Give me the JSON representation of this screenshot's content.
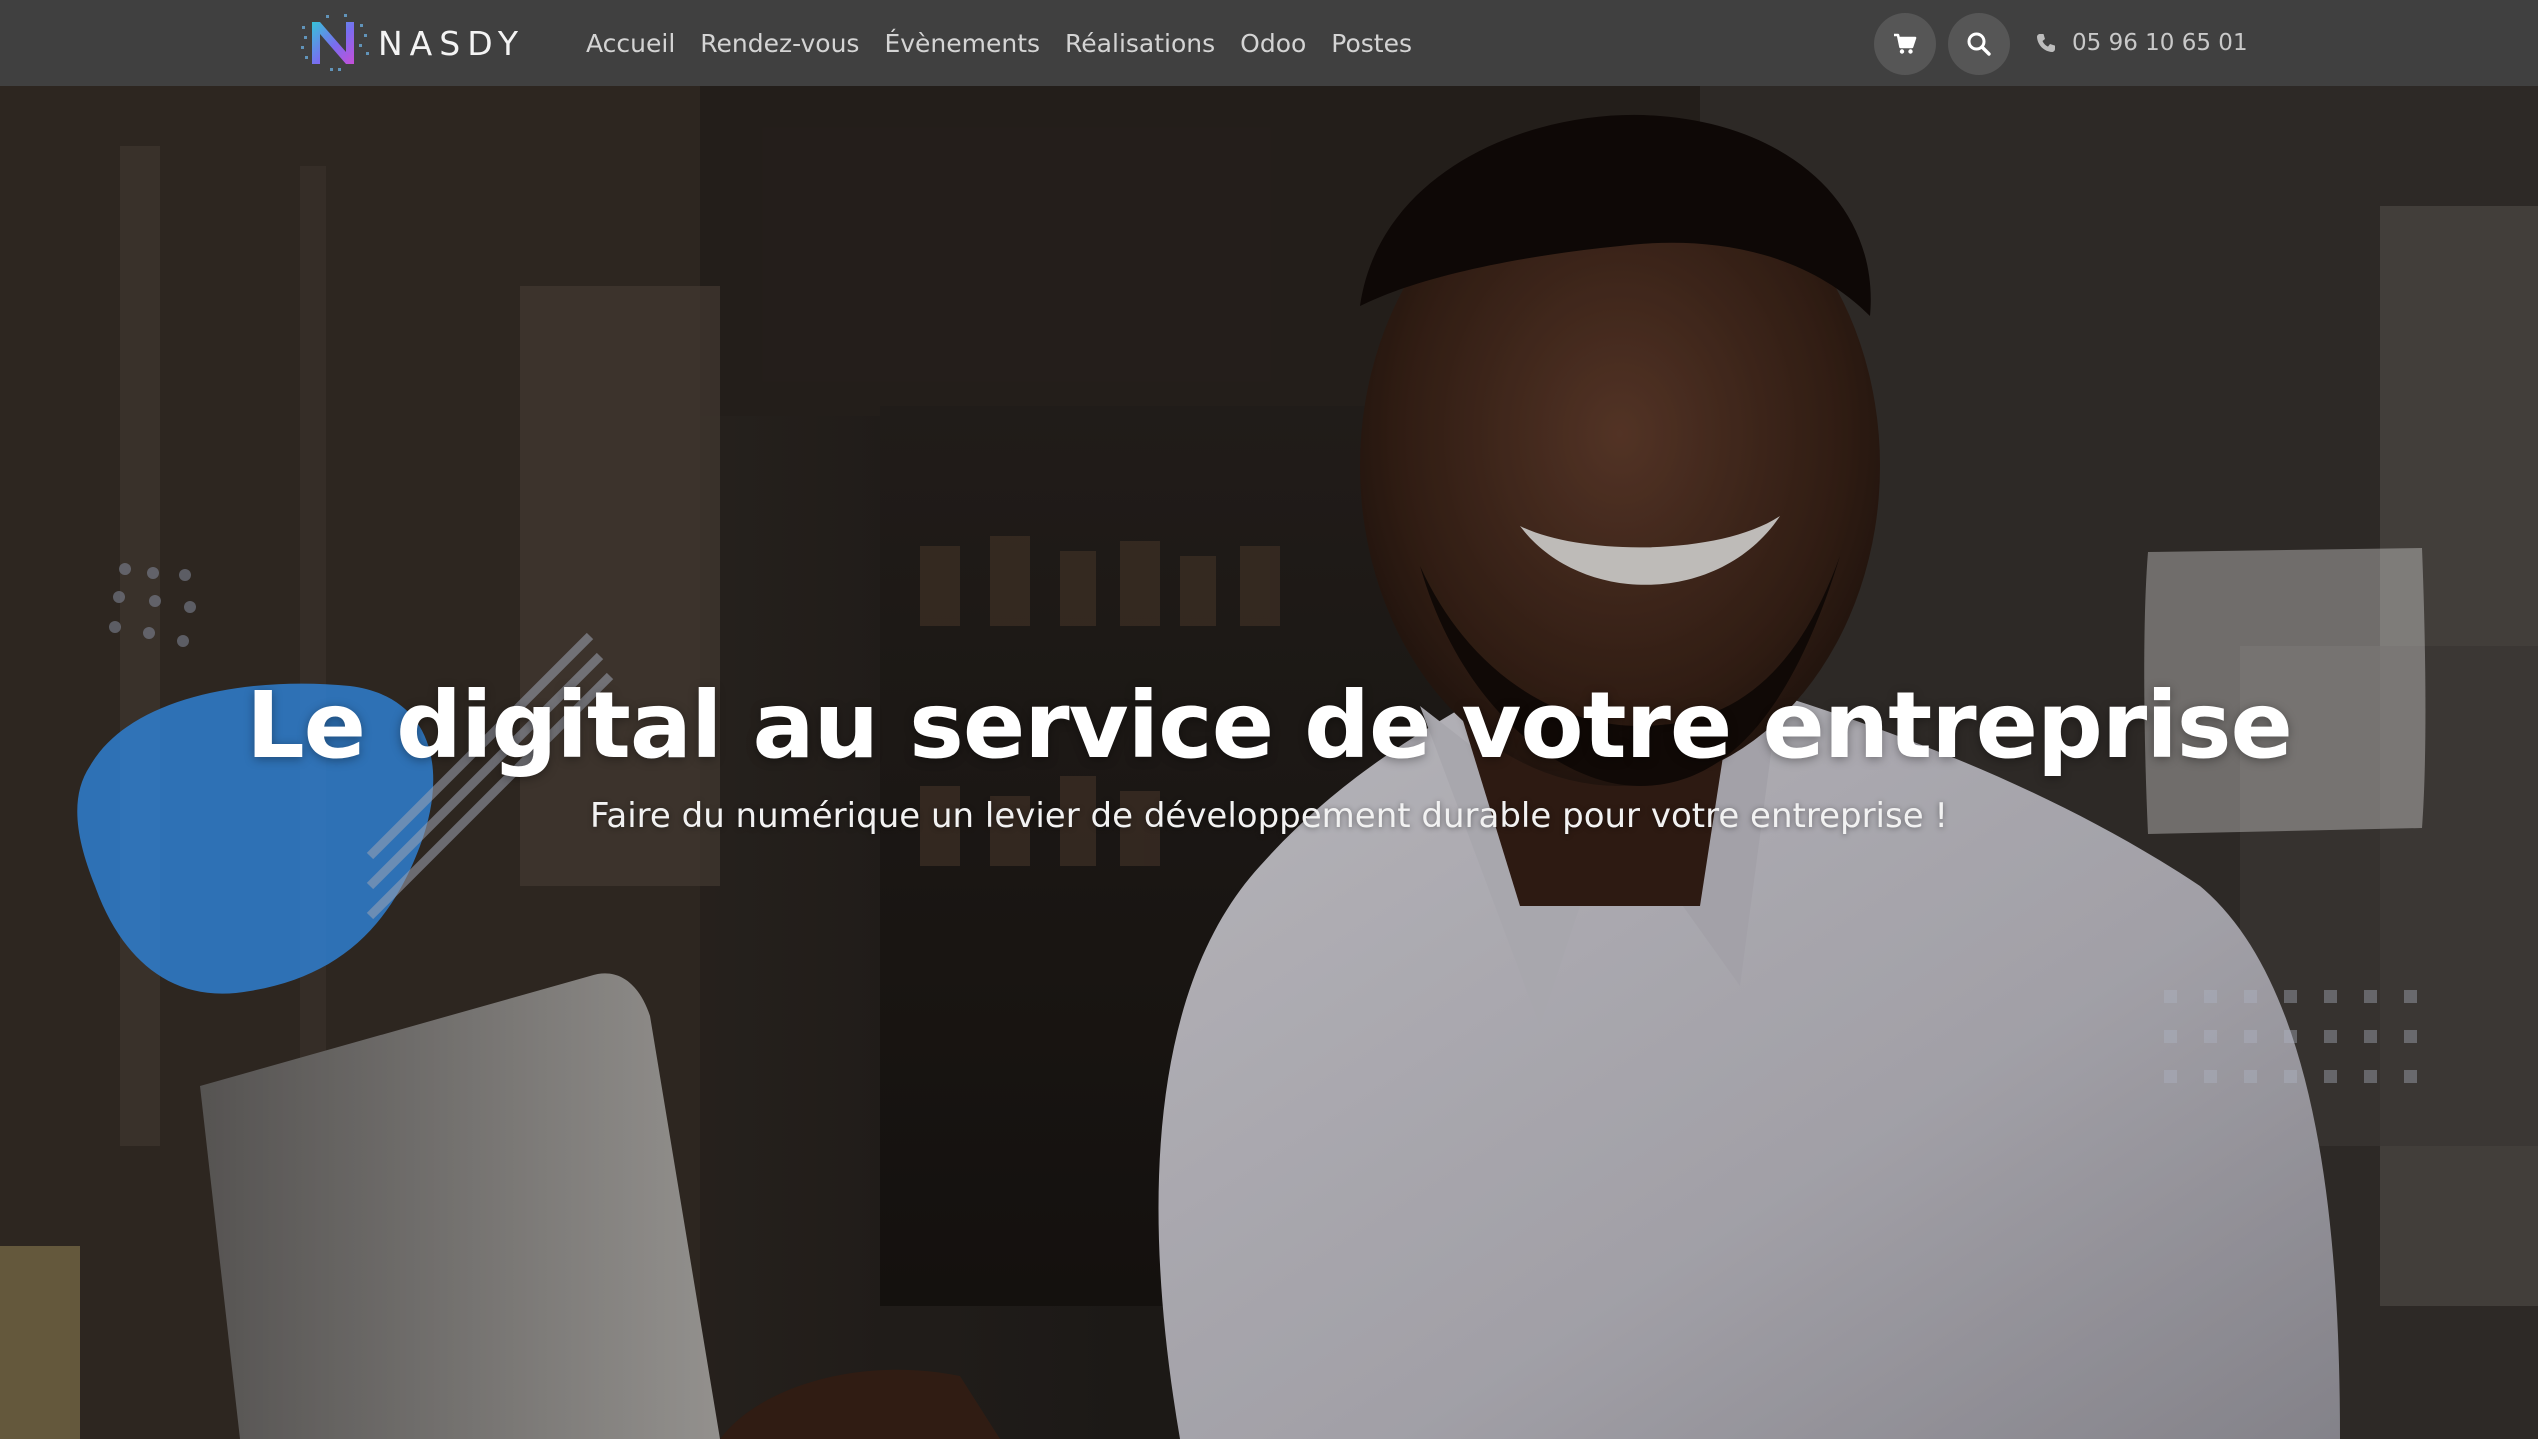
{
  "brand": {
    "name": "NASDY",
    "logo_icon": "nasdy-n-logo-icon"
  },
  "nav": {
    "items": [
      {
        "label": "Accueil"
      },
      {
        "label": "Rendez-vous"
      },
      {
        "label": "Évènements"
      },
      {
        "label": "Réalisations"
      },
      {
        "label": "Odoo"
      },
      {
        "label": "Postes"
      }
    ]
  },
  "header_actions": {
    "cart_icon": "shopping-cart-icon",
    "search_icon": "search-icon",
    "phone_icon": "phone-icon",
    "phone": "05 96 10 65 01"
  },
  "hero": {
    "title": "Le digital au service de votre entreprise",
    "subtitle": "Faire du numérique un levier de développement durable pour votre entreprise !"
  },
  "colors": {
    "navbar_bg": "#404040",
    "accent_blue": "#2f7fd0",
    "text_white": "#ffffff"
  }
}
